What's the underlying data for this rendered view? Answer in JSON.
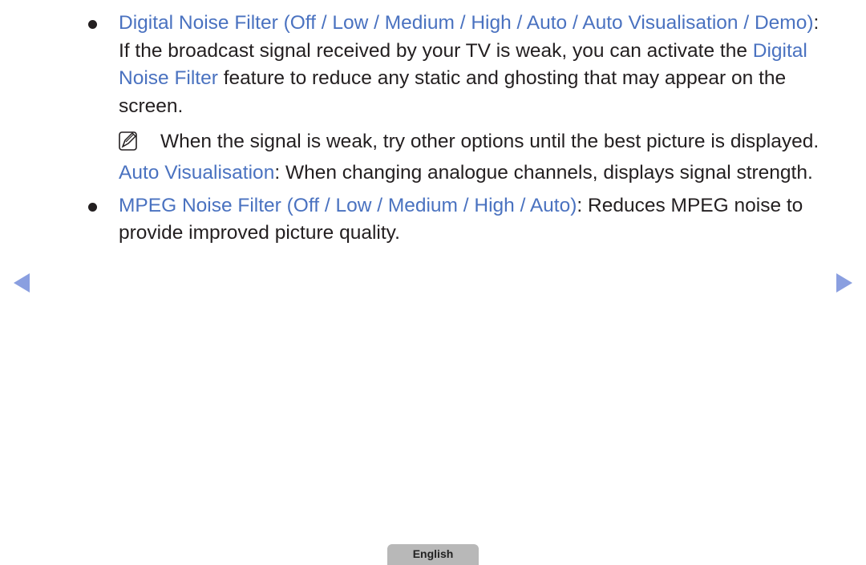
{
  "items": [
    {
      "heading_a": "Digital Noise Filter (Off / Low / Medium / High / Auto / Auto Visualisation / Demo",
      "heading_close": ")",
      "text_a": ": If the broadcast signal received by your TV is weak, you can activate the ",
      "inline_hl": "Digital Noise Filter",
      "text_b": " feature to reduce any static and ghosting that may appear on the screen.",
      "note": "When the signal is weak, try other options until the best picture is displayed.",
      "sub_hl": "Auto Visualisation",
      "sub_text": ": When changing analogue channels, displays signal strength."
    },
    {
      "heading_a": "MPEG Noise Filter (Off / Low / Medium / High / Auto",
      "heading_close": ")",
      "text_a": ": Reduces MPEG noise to provide improved picture quality."
    }
  ],
  "nav": {
    "prev": "previous-page",
    "next": "next-page"
  },
  "language_label": "English",
  "colors": {
    "highlight": "#4a72c0",
    "arrow": "#8a9fe0",
    "text": "#231f20"
  }
}
